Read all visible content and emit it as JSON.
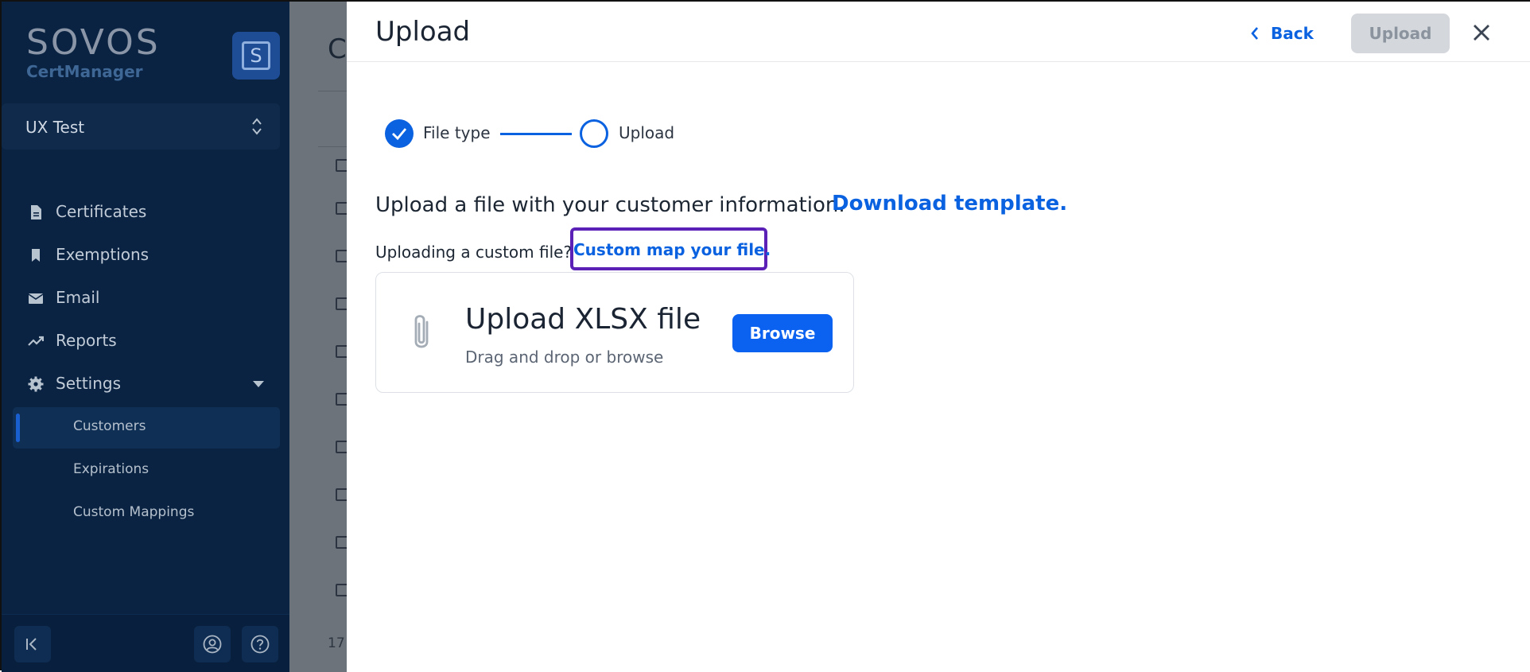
{
  "sidebar": {
    "brand": {
      "logo": "SOVOS",
      "product": "CertManager",
      "badge": "S"
    },
    "workspace": "UX Test",
    "items": [
      {
        "label": "Certificates",
        "icon": "document-icon"
      },
      {
        "label": "Exemptions",
        "icon": "bookmark-icon"
      },
      {
        "label": "Email",
        "icon": "envelope-icon"
      },
      {
        "label": "Reports",
        "icon": "trend-icon"
      },
      {
        "label": "Settings",
        "icon": "gear-icon"
      }
    ],
    "sub_items": [
      {
        "label": "Customers",
        "active": true
      },
      {
        "label": "Expirations",
        "active": false
      },
      {
        "label": "Custom Mappings",
        "active": false
      }
    ]
  },
  "background": {
    "title_fragment": "C",
    "footer_fragment": "17"
  },
  "drawer": {
    "title": "Upload",
    "back_label": "Back",
    "upload_label": "Upload",
    "stepper": {
      "step1": "File type",
      "step2": "Upload"
    },
    "intro_text": "Upload a file with your customer information.",
    "download_link": "Download template.",
    "custom_question": "Uploading a custom file?",
    "custom_link": "Custom map your file.",
    "card": {
      "title": "Upload XLSX file",
      "subtitle": "Drag and drop or browse",
      "browse_label": "Browse"
    }
  },
  "colors": {
    "accent": "#0b62e0",
    "sidebar": "#0a2342",
    "highlight": "#5b21b6"
  }
}
